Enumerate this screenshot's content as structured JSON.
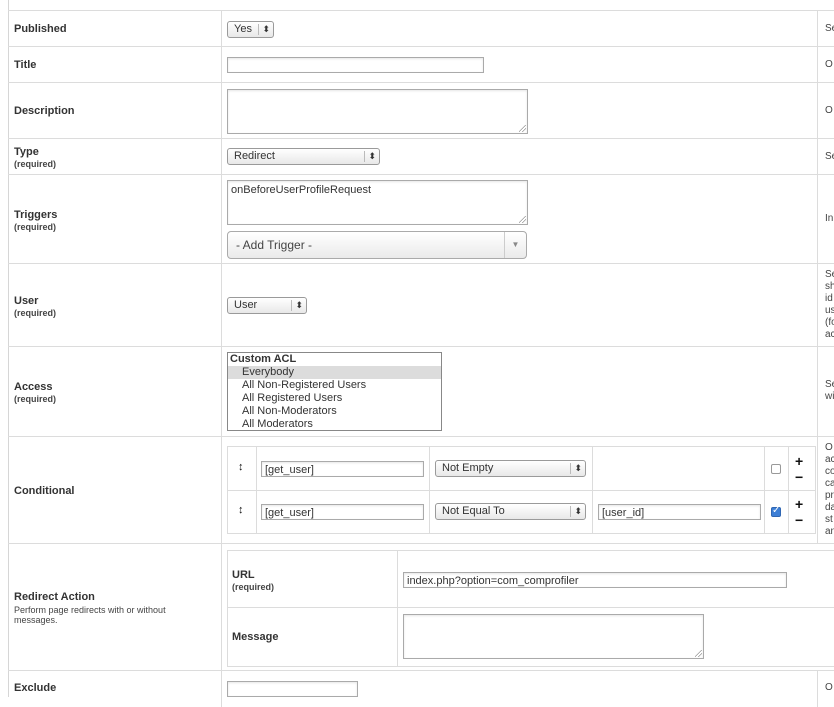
{
  "rows": {
    "published": {
      "label": "Published",
      "value": "Yes",
      "desc": "Se"
    },
    "title": {
      "label": "Title",
      "value": "",
      "desc": "O"
    },
    "description": {
      "label": "Description",
      "value": "",
      "desc": "O"
    },
    "type": {
      "label": "Type",
      "required": "(required)",
      "value": "Redirect",
      "desc": "Se"
    },
    "triggers": {
      "label": "Triggers",
      "required": "(required)",
      "value": "onBeforeUserProfileRequest",
      "add_trigger": "- Add Trigger -",
      "desc": "In"
    },
    "user": {
      "label": "User",
      "required": "(required)",
      "value": "User",
      "desc": [
        "Se",
        "sh",
        "id",
        "us",
        "(fo",
        "ac"
      ]
    },
    "access": {
      "label": "Access",
      "required": "(required)",
      "options": [
        "Custom ACL",
        "Everybody",
        "All Non-Registered Users",
        "All Registered Users",
        "All Non-Moderators",
        "All Moderators"
      ],
      "selected": "Everybody",
      "desc": [
        "Se",
        "wi"
      ]
    },
    "conditional": {
      "label": "Conditional",
      "rows": [
        {
          "field": "[get_user]",
          "operator": "Not Empty",
          "value": "",
          "checked": false
        },
        {
          "field": "[get_user]",
          "operator": "Not Equal To",
          "value": "[user_id]",
          "checked": true
        }
      ],
      "desc": [
        "O",
        "ac",
        "co",
        "ca",
        "pr",
        "da",
        "st",
        "an"
      ]
    },
    "redirect": {
      "label": "Redirect Action",
      "sub": "Perform page redirects with or without messages.",
      "url_label": "URL",
      "url_required": "(required)",
      "url_value": "index.php?option=com_comprofiler",
      "message_label": "Message",
      "message_value": ""
    },
    "exclude": {
      "label": "Exclude",
      "value": "",
      "desc": "O"
    }
  },
  "icons": {
    "plus": "+",
    "minus": "−",
    "move": "↕",
    "updown": "⬍",
    "caret": "▼"
  }
}
